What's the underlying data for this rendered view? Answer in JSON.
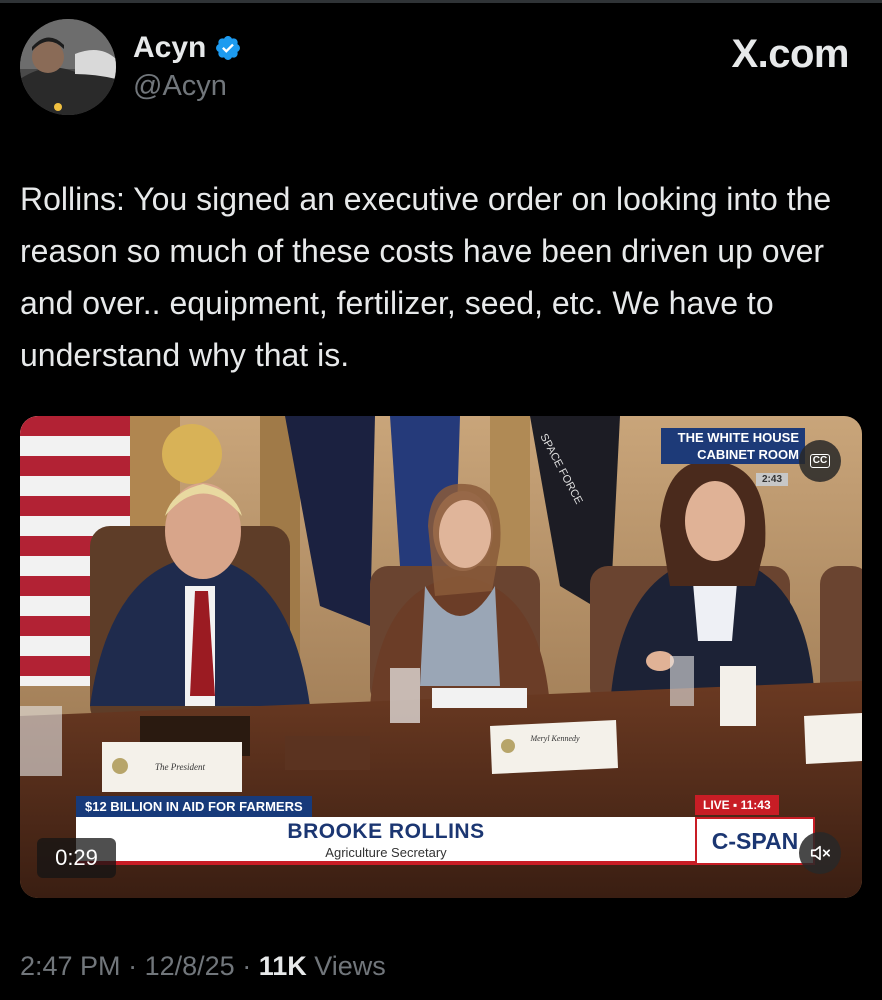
{
  "author": {
    "name": "Acyn",
    "handle": "@Acyn",
    "verified_icon": "verified-badge-icon",
    "verified_color": "#1d9bf0"
  },
  "brand": "X.com",
  "tweet": {
    "text": "Rollins: You signed an executive order on looking into the reason so much of these costs have been driven up over and over.. equipment, fertilizer, seed, etc. We have to understand why that is."
  },
  "video": {
    "duration": "0:29",
    "overlay_location_line1": "THE WHITE HOUSE",
    "overlay_location_line2": "CABINET ROOM",
    "overlay_clock": "2:43",
    "cc_label": "CC",
    "banner_headline": "$12 BILLION IN AID FOR FARMERS",
    "speaker_name": "BROOKE ROLLINS",
    "speaker_title": "Agriculture Secretary",
    "live_label": "LIVE",
    "live_time": "11:43",
    "network": "C-SPAN",
    "placard_left": "The President",
    "placard_mid": "Meryl Kennedy",
    "flag_text": "SPACE FORCE",
    "mute_icon": "speaker-muted-icon"
  },
  "footer": {
    "time": "2:47 PM",
    "date": "12/8/25",
    "views_count": "11K",
    "views_label": "Views"
  },
  "colors": {
    "background": "#000000",
    "primary_text": "#e7e9ea",
    "secondary_text": "#71767b",
    "cspan_blue": "#1b3672",
    "cspan_red": "#c81d25"
  }
}
